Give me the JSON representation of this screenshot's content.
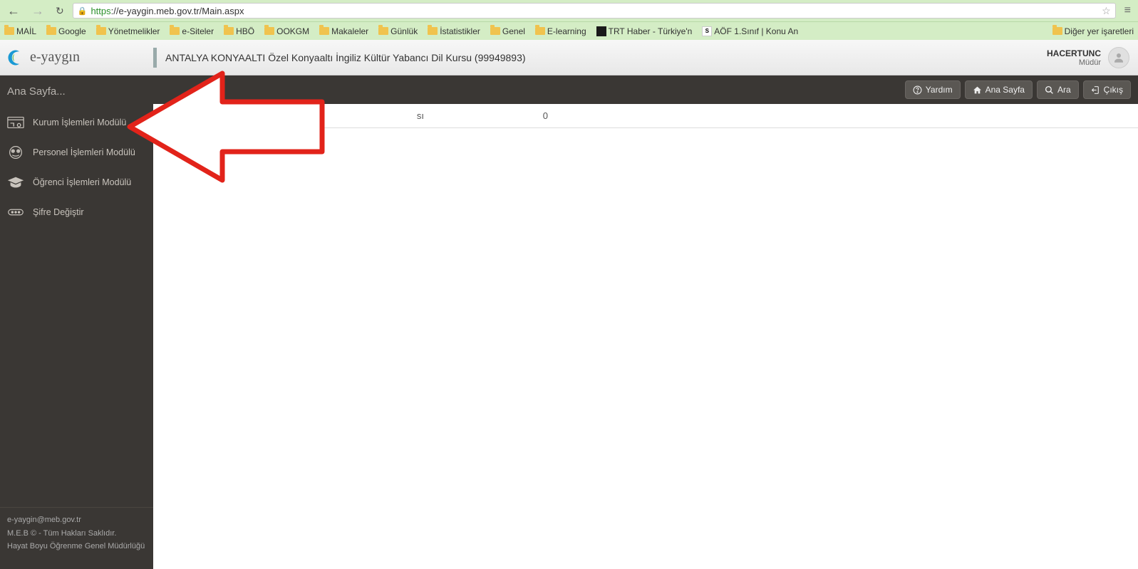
{
  "browser": {
    "url_scheme": "https",
    "url_rest": "://e-yaygin.meb.gov.tr/Main.aspx"
  },
  "bookmarks": {
    "items": [
      "MAİL",
      "Google",
      "Yönetmelikler",
      "e-Siteler",
      "HBÖ",
      "OOKGM",
      "Makaleler",
      "Günlük",
      "İstatistikler",
      "Genel",
      "E-learning"
    ],
    "trt": "TRT Haber - Türkiye'n",
    "aof": "AÖF 1.Sınıf | Konu An",
    "more": "Diğer yer işaretleri"
  },
  "header": {
    "logo_text": "e-yaygın",
    "institution": "ANTALYA KONYAALTI Özel Konyaaltı İngiliz Kültür Yabancı Dil Kursu (99949893)",
    "user_name": "HACERTUNC",
    "user_role": "Müdür"
  },
  "sidebar": {
    "title": "Ana Sayfa...",
    "items": [
      {
        "label": "Kurum İşlemleri Modülü"
      },
      {
        "label": "Personel İşlemleri Modülü"
      },
      {
        "label": "Öğrenci İşlemleri Modülü"
      },
      {
        "label": "Şifre Değiştir"
      }
    ],
    "footer_email": "e-yaygin@meb.gov.tr",
    "footer_copy": "M.E.B © - Tüm Hakları Saklıdır.",
    "footer_org": "Hayat Boyu Öğrenme Genel Müdürlüğü"
  },
  "toolbar": {
    "help": "Yardım",
    "home": "Ana Sayfa",
    "search": "Ara",
    "exit": "Çıkış"
  },
  "content": {
    "row_label_partial": "sı",
    "row_value": "0"
  }
}
